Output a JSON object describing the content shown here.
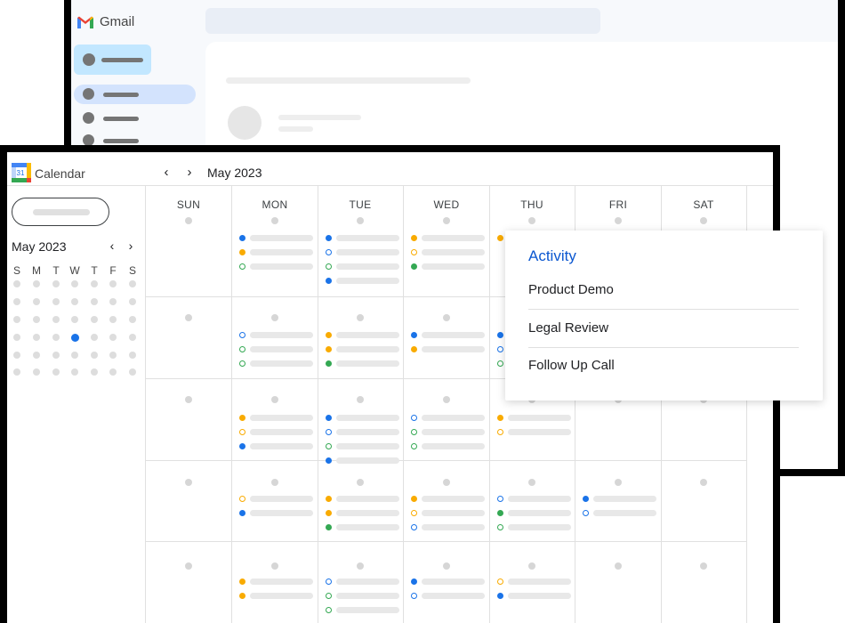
{
  "gmail": {
    "app_name": "Gmail"
  },
  "calendar": {
    "app_name": "Calendar",
    "logo_number": "31",
    "month_label": "May 2023",
    "mini_month_label": "May 2023",
    "mini_dow": [
      "S",
      "M",
      "T",
      "W",
      "T",
      "F",
      "S"
    ],
    "weekdays": [
      "SUN",
      "MON",
      "TUE",
      "WED",
      "THU",
      "FRI",
      "SAT"
    ],
    "nav_prev_icon": "chevron-left-icon",
    "nav_next_icon": "chevron-right-icon"
  },
  "popup": {
    "title": "Activity",
    "items": [
      "Product Demo",
      "Legal Review",
      "Follow Up Call"
    ]
  },
  "colors": {
    "blue": "#1a73e8",
    "yellow": "#f9ab00",
    "green": "#34a853",
    "popup_title": "#0b57d0"
  }
}
